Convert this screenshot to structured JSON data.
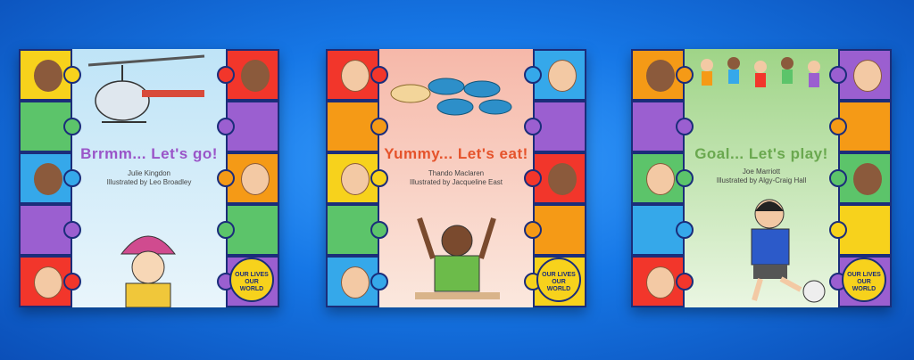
{
  "books": [
    {
      "title": "Brrmm... Let's go!",
      "author": "Julie Kingdon",
      "illustrator": "Illustrated by Leo Broadley",
      "badge": "OUR LIVES OUR WORLD"
    },
    {
      "title": "Yummy... Let's eat!",
      "author": "Thando Maclaren",
      "illustrator": "Illustrated by Jacqueline East",
      "badge": "OUR LIVES OUR WORLD"
    },
    {
      "title": "Goal... Let's play!",
      "author": "Joe Marriott",
      "illustrator": "Illustrated by Algy-Craig Hall",
      "badge": "OUR LIVES OUR WORLD"
    }
  ],
  "colors": {
    "background": "#1677e6",
    "puzzle": [
      "#f2362b",
      "#f59a16",
      "#5cc46a",
      "#35a8ea",
      "#9b5fd0",
      "#f7d21c"
    ]
  }
}
